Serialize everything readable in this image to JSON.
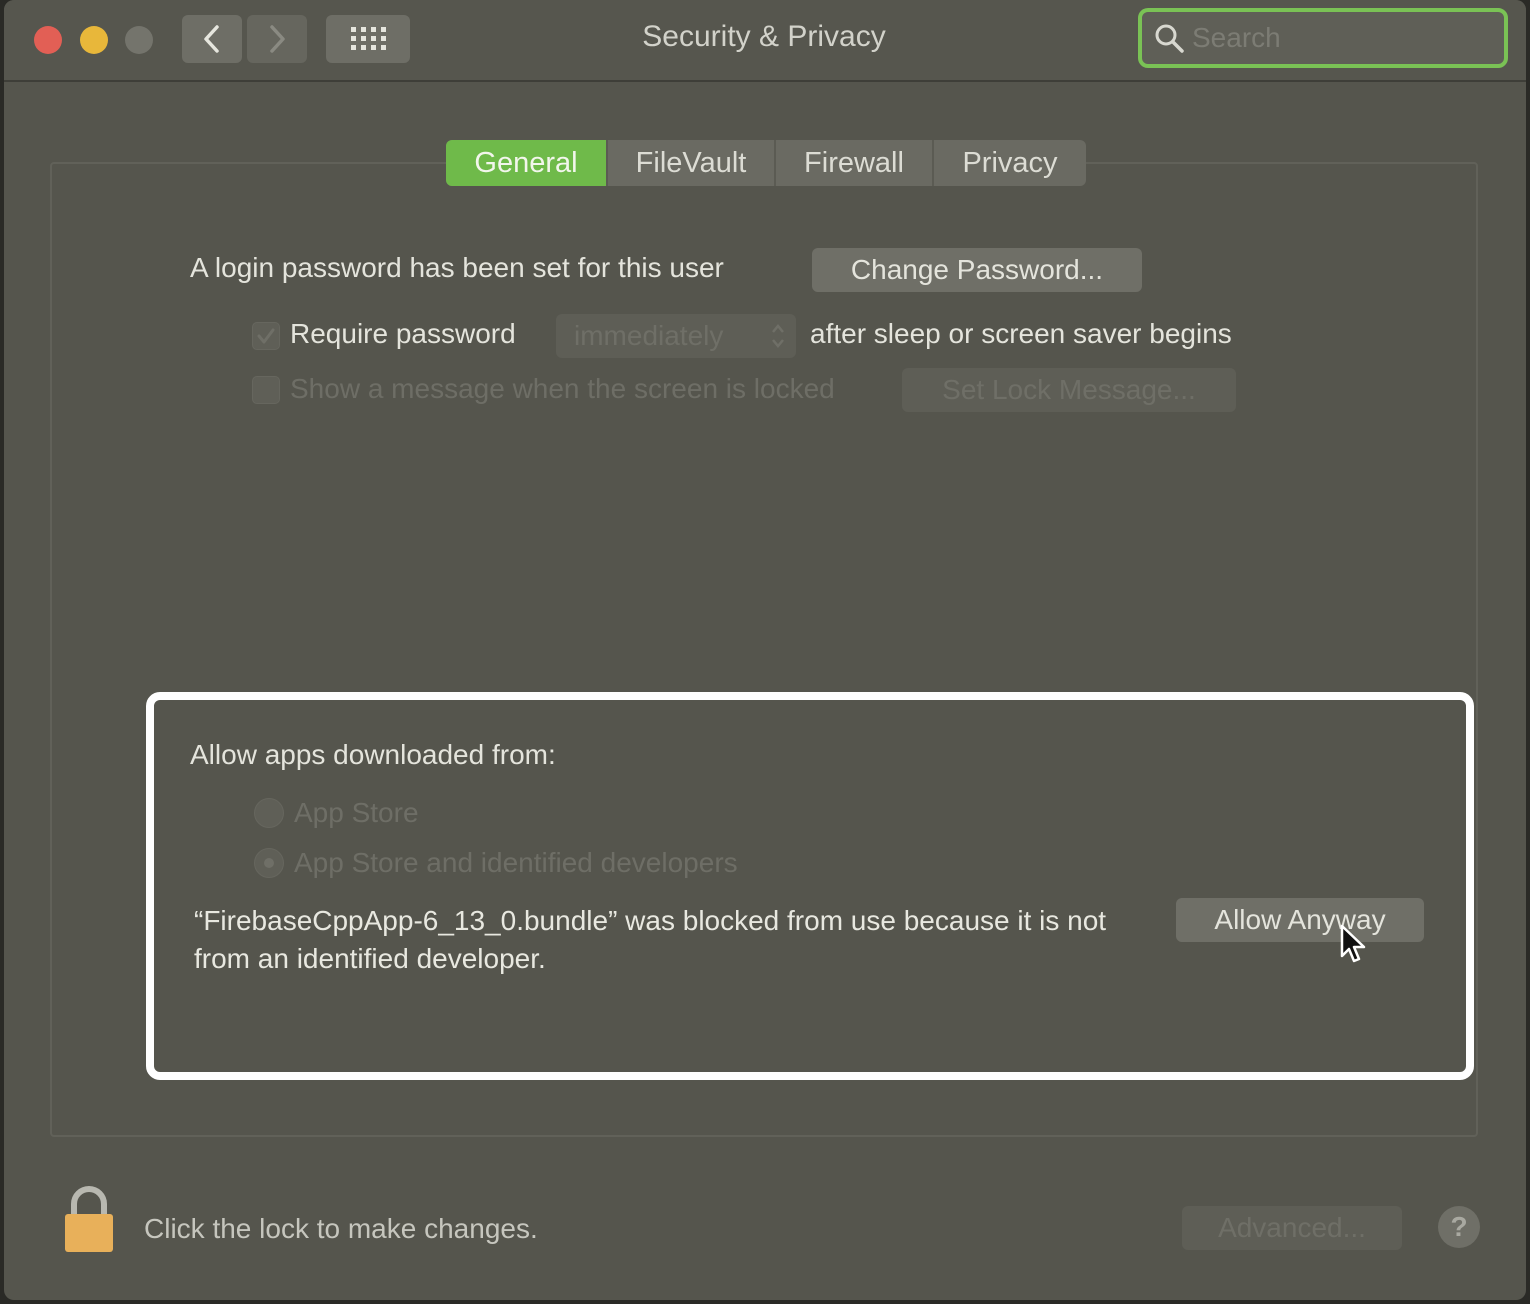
{
  "window": {
    "title": "Security & Privacy",
    "search_placeholder": "Search"
  },
  "tabs": [
    {
      "label": "General",
      "active": true
    },
    {
      "label": "FileVault",
      "active": false
    },
    {
      "label": "Firewall",
      "active": false
    },
    {
      "label": "Privacy",
      "active": false
    }
  ],
  "general": {
    "login_text": "A login password has been set for this user",
    "change_password_label": "Change Password...",
    "require_password_label": "Require password",
    "require_password_checked": true,
    "require_password_delay": "immediately",
    "after_sleep_text": "after sleep or screen saver begins",
    "show_message_label": "Show a message when the screen is locked",
    "show_message_checked": false,
    "set_lock_message_label": "Set Lock Message..."
  },
  "downloads": {
    "heading": "Allow apps downloaded from:",
    "options": [
      {
        "label": "App Store",
        "selected": false
      },
      {
        "label": "App Store and identified developers",
        "selected": true
      }
    ],
    "blocked_message": "“FirebaseCppApp-6_13_0.bundle” was blocked from use because it is not from an identified developer.",
    "allow_anyway_label": "Allow Anyway"
  },
  "footer": {
    "lock_text": "Click the lock to make changes.",
    "advanced_label": "Advanced...",
    "help_label": "?"
  },
  "colors": {
    "accent_green": "#6fba4a",
    "highlight_border": "#ffffff",
    "lock_gold": "#e8b05a"
  }
}
